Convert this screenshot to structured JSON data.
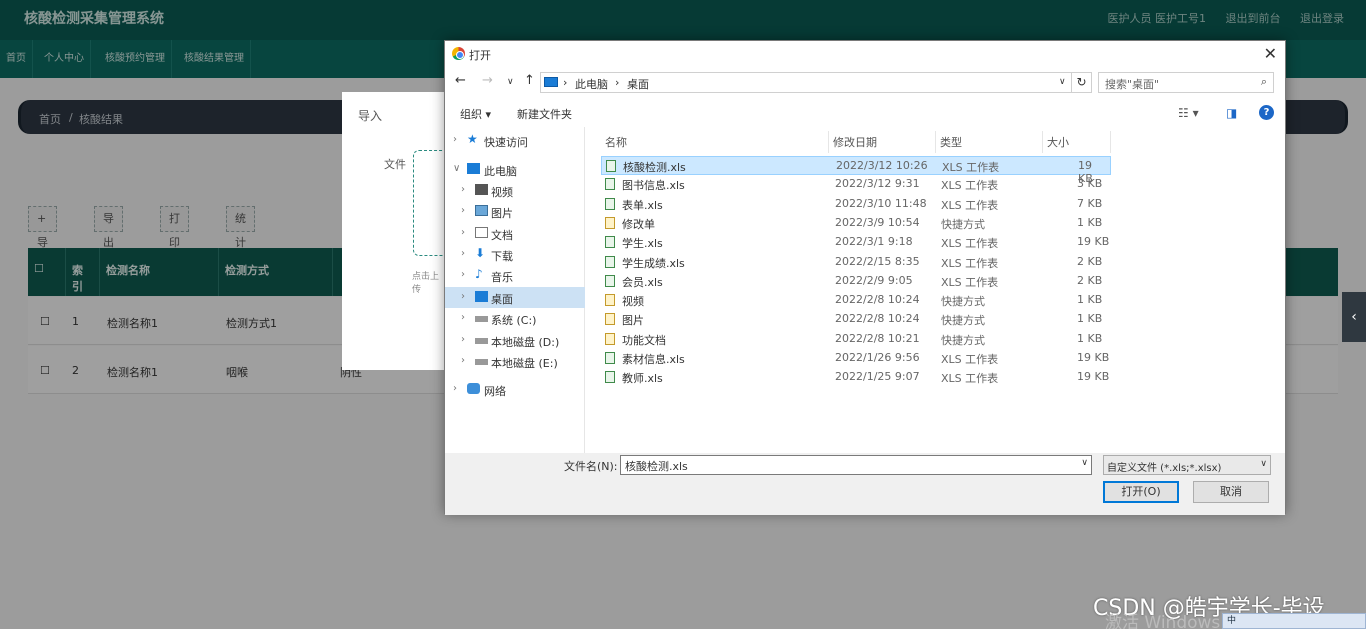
{
  "app": {
    "title": "核酸检测采集管理系统",
    "user_links": [
      "医护人员 医护工号1",
      "退出到前台",
      "退出登录"
    ],
    "nav": [
      "首页",
      "个人中心",
      "核酸预约管理",
      "核酸结果管理"
    ],
    "breadcrumb": {
      "home": "首页",
      "sep": "/",
      "current": "核酸结果"
    },
    "toolbar": [
      "+ 导入",
      "导出",
      "打印",
      "统计报表"
    ],
    "table": {
      "headers": [
        "索引",
        "检测名称",
        "检测方式"
      ],
      "rows": [
        {
          "index": "1",
          "name": "检测名称1",
          "method": "检测方式1"
        },
        {
          "index": "2",
          "name": "检测名称1",
          "method": "咽喉",
          "extra": "阴性"
        }
      ]
    }
  },
  "import_dialog": {
    "title": "导入",
    "file_label": "文件",
    "hint": "点击上传"
  },
  "open_dialog": {
    "title": "打开",
    "path": [
      "此电脑",
      "桌面"
    ],
    "search_placeholder": "搜索\"桌面\"",
    "commands": {
      "organize": "组织 ▾",
      "new_folder": "新建文件夹"
    },
    "tree": [
      {
        "label": "快速访问",
        "icon": "star-icon"
      },
      {
        "label": "此电脑",
        "icon": "computer-icon"
      },
      {
        "label": "视频",
        "icon": "video-icon"
      },
      {
        "label": "图片",
        "icon": "picture-icon"
      },
      {
        "label": "文档",
        "icon": "document-icon"
      },
      {
        "label": "下载",
        "icon": "download-icon"
      },
      {
        "label": "音乐",
        "icon": "music-icon"
      },
      {
        "label": "桌面",
        "icon": "desktop-icon",
        "selected": true
      },
      {
        "label": "系统 (C:)",
        "icon": "drive-icon"
      },
      {
        "label": "本地磁盘 (D:)",
        "icon": "drive-icon"
      },
      {
        "label": "本地磁盘 (E:)",
        "icon": "drive-icon"
      },
      {
        "label": "网络",
        "icon": "network-icon"
      }
    ],
    "columns": [
      "名称",
      "修改日期",
      "类型",
      "大小"
    ],
    "files": [
      {
        "name": "核酸检测.xls",
        "date": "2022/3/12 10:26",
        "type": "XLS 工作表",
        "size": "19 KB",
        "selected": true
      },
      {
        "name": "图书信息.xls",
        "date": "2022/3/12 9:31",
        "type": "XLS 工作表",
        "size": "3 KB"
      },
      {
        "name": "表单.xls",
        "date": "2022/3/10 11:48",
        "type": "XLS 工作表",
        "size": "7 KB"
      },
      {
        "name": "修改单",
        "date": "2022/3/9 10:54",
        "type": "快捷方式",
        "size": "1 KB"
      },
      {
        "name": "学生.xls",
        "date": "2022/3/1 9:18",
        "type": "XLS 工作表",
        "size": "19 KB"
      },
      {
        "name": "学生成绩.xls",
        "date": "2022/2/15 8:35",
        "type": "XLS 工作表",
        "size": "2 KB"
      },
      {
        "name": "会员.xls",
        "date": "2022/2/9 9:05",
        "type": "XLS 工作表",
        "size": "2 KB"
      },
      {
        "name": "视频",
        "date": "2022/2/8 10:24",
        "type": "快捷方式",
        "size": "1 KB"
      },
      {
        "name": "图片",
        "date": "2022/2/8 10:24",
        "type": "快捷方式",
        "size": "1 KB"
      },
      {
        "name": "功能文档",
        "date": "2022/2/8 10:21",
        "type": "快捷方式",
        "size": "1 KB"
      },
      {
        "name": "素材信息.xls",
        "date": "2022/1/26 9:56",
        "type": "XLS 工作表",
        "size": "19 KB"
      },
      {
        "name": "教师.xls",
        "date": "2022/1/25 9:07",
        "type": "XLS 工作表",
        "size": "19 KB"
      }
    ],
    "filename_label": "文件名(N):",
    "filename_value": "核酸检测.xls",
    "filetype_value": "自定义文件 (*.xls;*.xlsx)",
    "open_button": "打开(O)",
    "cancel_button": "取消"
  },
  "watermark": {
    "text": "CSDN @皓宇学长-毕设",
    "activate": "激活 Windows"
  },
  "tray": "中"
}
